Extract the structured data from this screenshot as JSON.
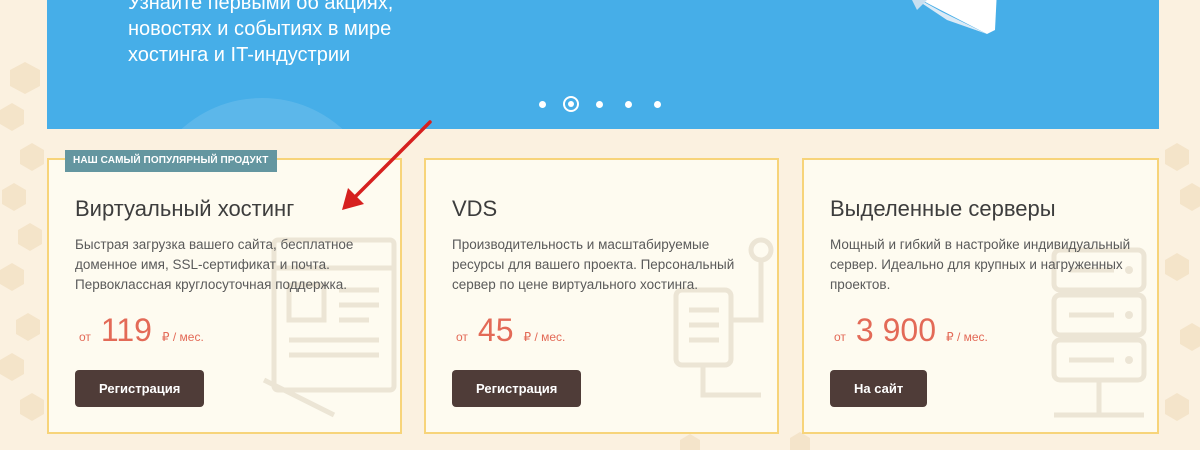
{
  "banner": {
    "text_lines": [
      "Узнайте первыми об акциях,",
      "новостях и событиях в мире",
      "хостинга и IT-индустрии"
    ],
    "slider_dots": 5,
    "active_dot": 2
  },
  "products": [
    {
      "badge": "НАШ САМЫЙ ПОПУЛЯРНЫЙ ПРОДУКТ",
      "title": "Виртуальный хостинг",
      "desc": [
        "Быстрая загрузка вашего сайта, бесплатное",
        "доменное имя, SSL-сертификат и почта.",
        "Первоклассная круглосуточная поддержка."
      ],
      "price_from": "от",
      "price": "119",
      "price_unit": "₽ / мес.",
      "button": "Регистрация"
    },
    {
      "title": "VDS",
      "desc": [
        "Производительность и масштабируемые",
        "ресурсы для вашего проекта. Персональный",
        "сервер по цене виртуального хостинга."
      ],
      "price_from": "от",
      "price": "45",
      "price_unit": "₽ / мес.",
      "button": "Регистрация"
    },
    {
      "title": "Выделенные серверы",
      "desc": [
        "Мощный и гибкий в настройке индивидуальный",
        "сервер. Идеально для крупных и нагруженных",
        "проектов."
      ],
      "price_from": "от",
      "price": "3 900",
      "price_unit": "₽ / мес.",
      "button": "На сайт"
    }
  ],
  "colors": {
    "banner_bg": "#46aee8",
    "card_border": "#f7d47a",
    "price": "#e36a57",
    "button_bg": "#4f3c38",
    "badge_bg": "#6496a0",
    "annotation_arrow": "#d6201f"
  },
  "icons": [
    "paper-plane-icon",
    "annotation-arrow-icon",
    "webpage-layout-icon",
    "server-network-icon",
    "server-rack-icon"
  ]
}
